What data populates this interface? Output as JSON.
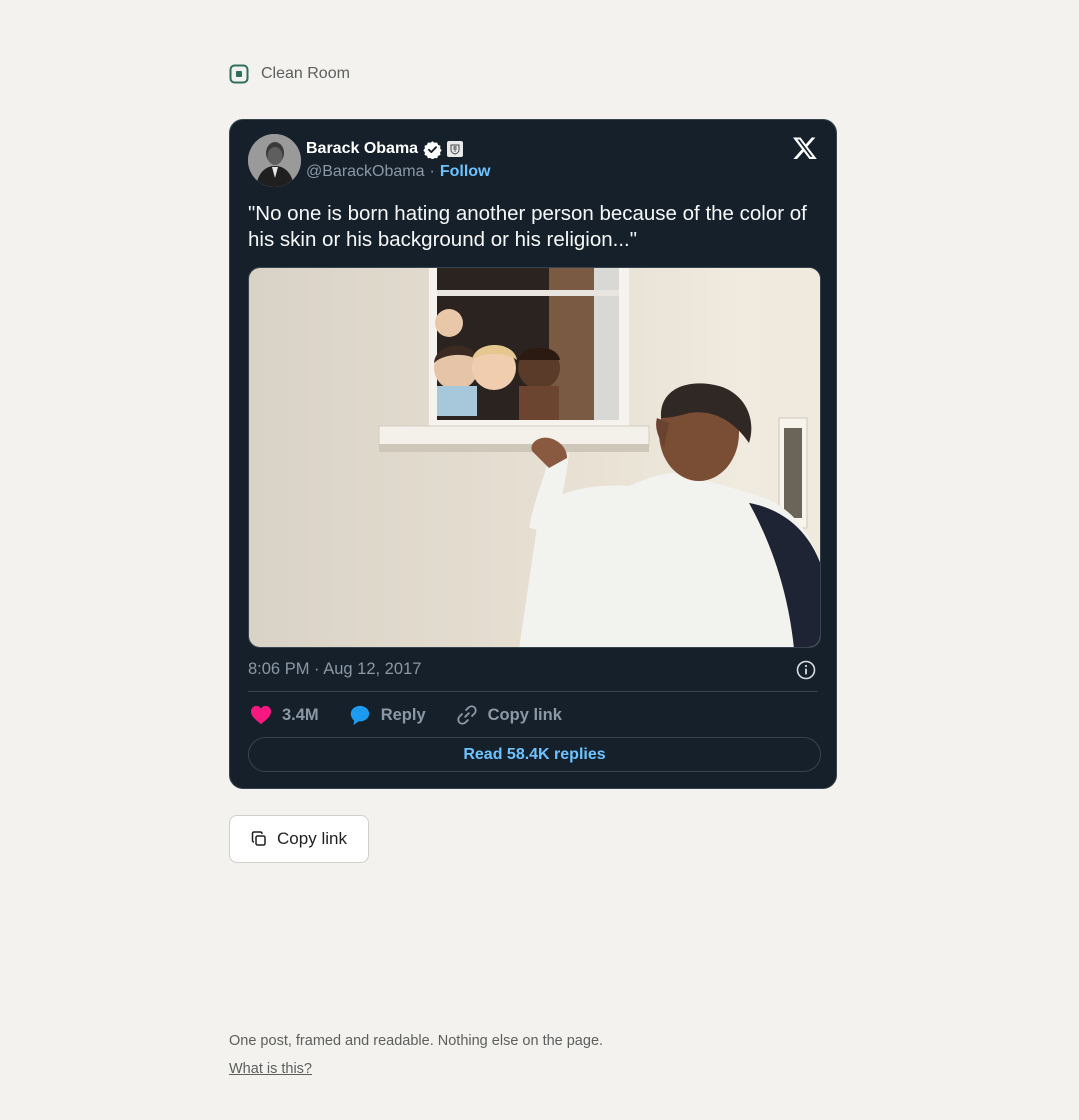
{
  "brand": {
    "name": "Clean Room",
    "icon": "app-logo-icon",
    "accent": "#2f6f5e"
  },
  "tweet": {
    "author_name": "Barack Obama",
    "handle": "@BarackObama",
    "separator": "·",
    "follow_label": "Follow",
    "text": "\"No one is born hating another person because of the color of his skin or his background or his religion...\"",
    "timestamp": "8:06 PM · Aug 12, 2017",
    "likes": "3.4M",
    "reply_label": "Reply",
    "copy_link_label": "Copy link",
    "read_replies_label": "Read 58.4K replies",
    "colors": {
      "background": "#15202b",
      "link": "#6cc3ff",
      "like": "#f91880",
      "reply": "#1d9bf0"
    }
  },
  "page": {
    "copy_button_label": "Copy link",
    "footer_text": "One post, framed and readable. Nothing else on the page.",
    "footer_link": "What is this?"
  }
}
